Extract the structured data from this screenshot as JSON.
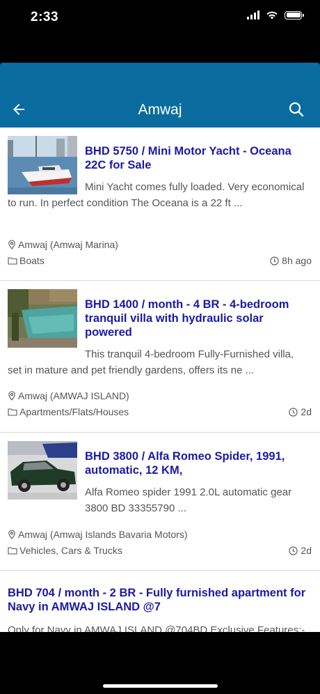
{
  "status_bar": {
    "time": "2:33"
  },
  "app_bar": {
    "title": "Amwaj"
  },
  "listings": [
    {
      "title": "BHD 5750 / Mini Motor Yacht - Oceana 22C for Sale",
      "description": "Mini Yacht comes fully loaded. Very economical to run. In perfect condition The Oceana is a 22 ft ...",
      "location": "Amwaj (Amwaj Marina)",
      "category": "Boats",
      "time": "8h ago"
    },
    {
      "title": "BHD 1400 / month - 4 BR - 4-bedroom tranquil villa with hydraulic solar powered",
      "description": "This tranquil 4-bedroom Fully-Furnished villa, set in mature and pet friendly gardens, offers its ne ...",
      "location": "Amwaj (AMWAJ ISLAND)",
      "category": "Apartments/Flats/Houses",
      "time": "2d"
    },
    {
      "title": "BHD 3800 / Alfa Romeo Spider, 1991, automatic, 12 KM,",
      "description": "Alfa Romeo spider 1991 2.0L automatic gear 3800 BD 33355790 ...",
      "location": "Amwaj (Amwaj Islands Bavaria Motors)",
      "category": "Vehicles, Cars & Trucks",
      "time": "2d"
    },
    {
      "title": "BHD 704 / month - 2 BR - Fully furnished apartment for Navy in AMWAJ ISLAND @7",
      "description": "Only for Navy in AMWAJ ISLAND @704BD Exclusive Features:-"
    }
  ],
  "colors": {
    "app_bar": "#0a6c9e",
    "title_link": "#1a1aa6",
    "text_secondary": "#555555"
  },
  "icons": {
    "back": "arrow-left",
    "search": "magnifier",
    "location": "map-pin",
    "category": "folder",
    "time": "clock"
  }
}
